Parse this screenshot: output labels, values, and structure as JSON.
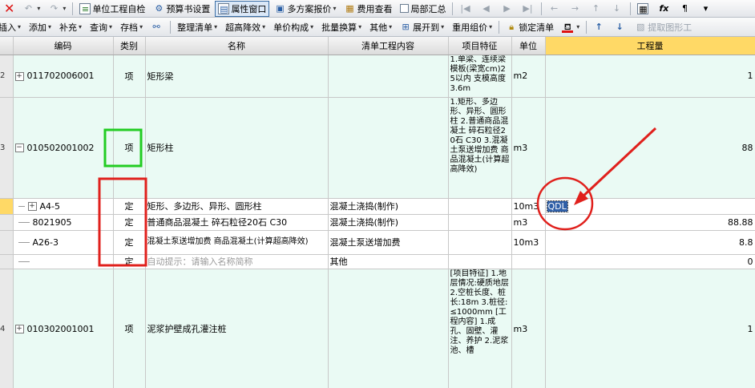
{
  "toolbar1": {
    "undo_icon": "undo-icon",
    "redo_icon": "redo-icon",
    "unit_check": "单位工程自检",
    "budget_settings": "预算书设置",
    "property_window": "属性窗口",
    "multi_quote": "多方案报价",
    "fee_view": "费用查看",
    "partial_summary": "局部汇总"
  },
  "toolbar2": {
    "insert": "插入",
    "add": "添加",
    "supplement": "补充",
    "query": "查询",
    "store": "存档",
    "organize": "整理清单",
    "over_height": "超高降效",
    "price_compose": "单价构成",
    "batch_convert": "批量换算",
    "other": "其他",
    "expand_to": "展开到",
    "regroup": "重用组价",
    "lock_list": "锁定清单",
    "extract": "提取图形工"
  },
  "grid": {
    "headers": {
      "code": "编码",
      "type": "类别",
      "name": "名称",
      "content": "清单工程内容",
      "feature": "项目特征",
      "unit": "单位",
      "qty": "工程量"
    },
    "rows": [
      {
        "rn": "2",
        "code": "011702006001",
        "type": "项",
        "name": "矩形梁",
        "content": "",
        "feature": "1.单梁、连续梁模板(梁宽cm)25以内 支模高度3.6m",
        "unit": "m2",
        "qty": "1"
      },
      {
        "rn": "3",
        "code": "010502001002",
        "type": "项",
        "name": "矩形柱",
        "content": "",
        "feature": "1.矩形、多边形、异形、圆形柱 2.普通商品混凝土 碎石粒径20石 C30 3.混凝土泵送增加费 商品混凝土(计算超高降效)",
        "unit": "m3",
        "qty": "88"
      },
      {
        "rn": "",
        "code": "A4-5",
        "type": "定",
        "name": "矩形、多边形、异形、圆形柱",
        "content": "混凝土浇捣(制作)",
        "feature": "",
        "unit": "10m3",
        "qty": "QDL"
      },
      {
        "rn": "",
        "code": "8021905",
        "type": "定",
        "name": "普通商品混凝土 碎石粒径20石 C30",
        "content": "混凝土浇捣(制作)",
        "feature": "",
        "unit": "m3",
        "qty": "88.88"
      },
      {
        "rn": "",
        "code": "A26-3",
        "type": "定",
        "name": "混凝土泵送增加费 商品混凝土(计算超高降效)",
        "content": "混凝土泵送增加费",
        "feature": "",
        "unit": "10m3",
        "qty": "8.8"
      },
      {
        "rn": "",
        "code": "",
        "type": "定",
        "name": "自动提示：请输入名称简称",
        "content": "其他",
        "feature": "",
        "unit": "",
        "qty": "0"
      },
      {
        "rn": "4",
        "code": "010302001001",
        "type": "项",
        "name": "泥浆护壁成孔灌注桩",
        "content": "",
        "feature": "[项目特征] 1.地层情况:硬质地层 2.空桩长度、桩长:18m 3.桩径:≤1000mm [工程内容] 1.成孔、固壁、灌注、养护 2.泥浆池、槽",
        "unit": "m3",
        "qty": "1"
      }
    ]
  },
  "colors": {
    "annotation_red": "#e0201c",
    "annotation_green": "#22cc22",
    "qty_header": "#ffd966",
    "item_row": "#eafaf4"
  }
}
